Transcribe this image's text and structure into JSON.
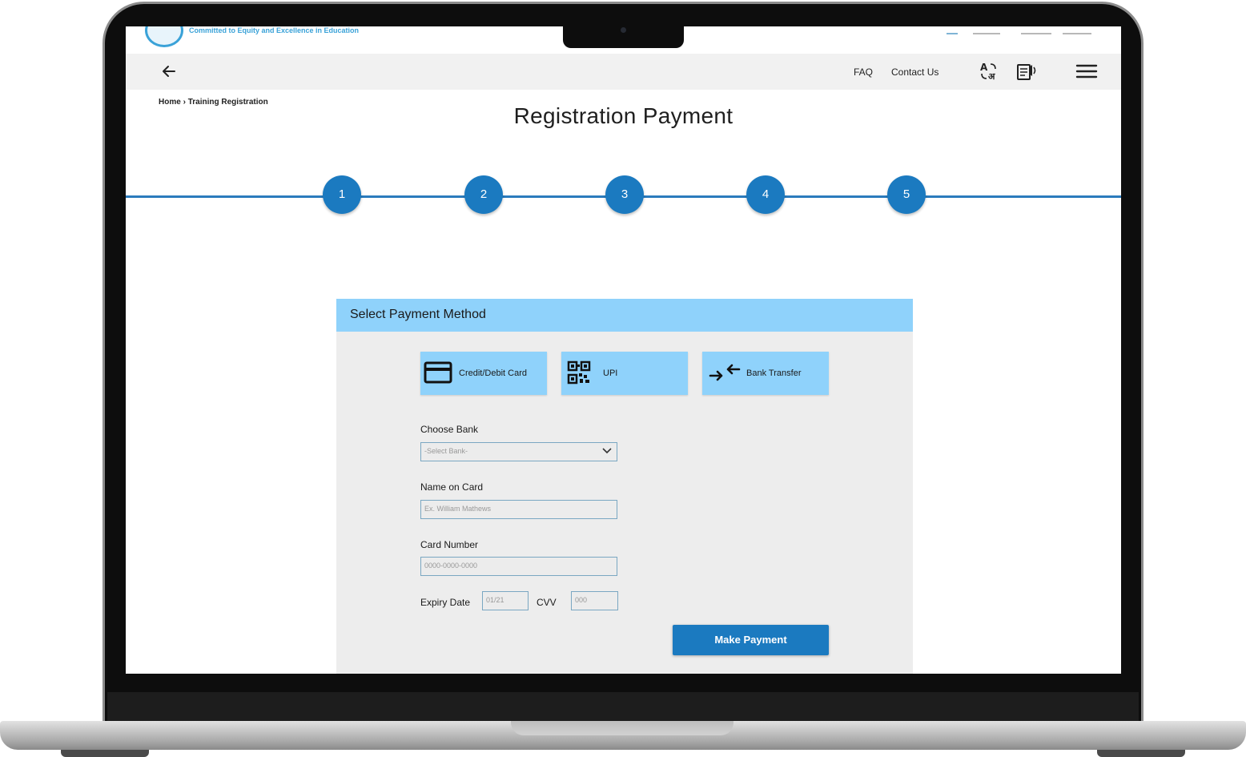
{
  "header": {
    "tagline": "Committed to Equity and Excellence in Education"
  },
  "nav": {
    "faq": "FAQ",
    "contact": "Contact Us"
  },
  "breadcrumb": {
    "home": "Home",
    "separator": "›",
    "current": "Training Registration"
  },
  "page_title": "Registration Payment",
  "steps": [
    "1",
    "2",
    "3",
    "4",
    "5"
  ],
  "payment": {
    "section_title": "Select Payment Method",
    "methods": [
      {
        "label": "Credit/Debit Card",
        "icon": "credit-card-icon"
      },
      {
        "label": "UPI",
        "icon": "qr-code-icon"
      },
      {
        "label": "Bank Transfer",
        "icon": "transfer-arrows-icon"
      }
    ],
    "bank_label": "Choose Bank",
    "bank_selected": "-Select Bank-",
    "name_label": "Name on Card",
    "name_placeholder": "Ex. William Mathews",
    "card_label": "Card Number",
    "card_placeholder": "0000-0000-0000",
    "expiry_label": "Expiry Date",
    "expiry_placeholder": "01/21",
    "cvv_label": "CVV",
    "cvv_placeholder": "000",
    "submit_label": "Make Payment"
  },
  "colors": {
    "primary": "#1b7ac0",
    "header_blue": "#8fd2fb",
    "panel_bg": "#ededed"
  }
}
